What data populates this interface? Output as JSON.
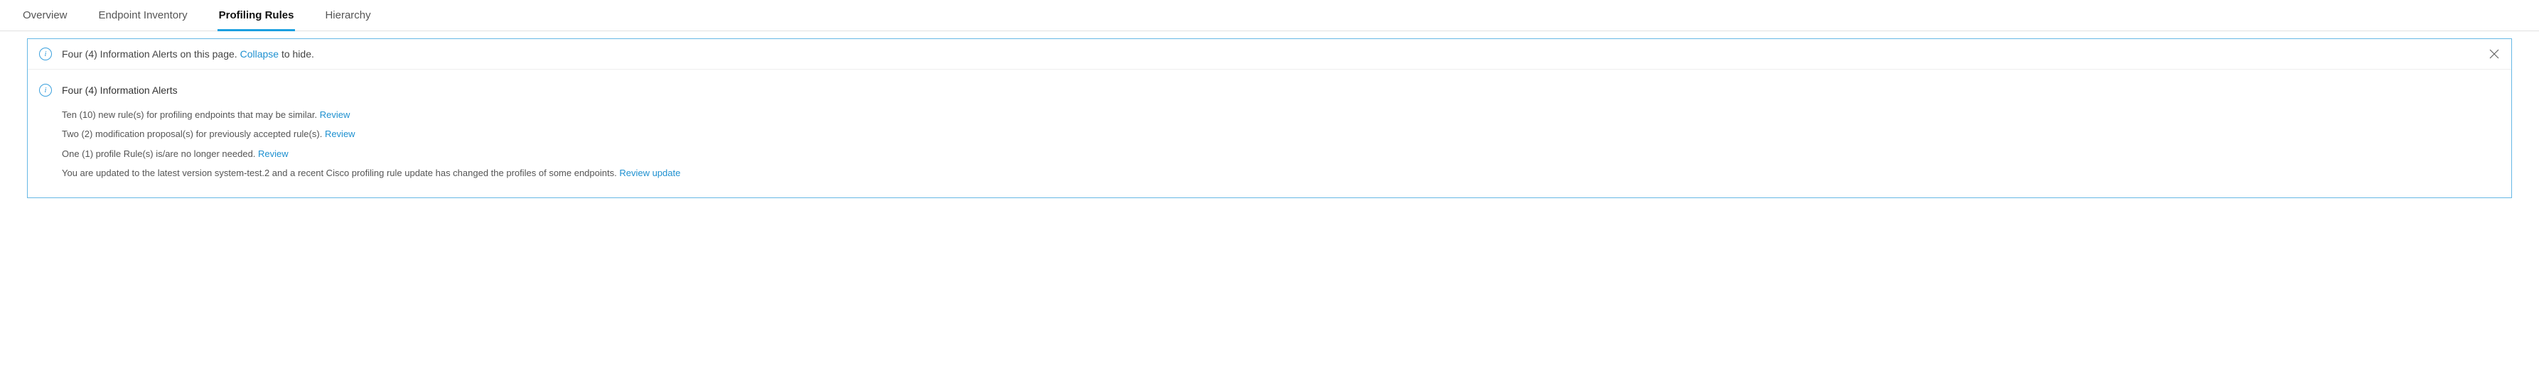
{
  "tabs": [
    {
      "label": "Overview",
      "active": false
    },
    {
      "label": "Endpoint Inventory",
      "active": false
    },
    {
      "label": "Profiling Rules",
      "active": true
    },
    {
      "label": "Hierarchy",
      "active": false
    }
  ],
  "alert": {
    "summary_prefix": "Four (4) Information Alerts on this page. ",
    "collapse_link": "Collapse",
    "summary_suffix": " to hide.",
    "details_title": "Four (4) Information Alerts",
    "items": [
      {
        "text": "Ten (10) new rule(s) for profiling endpoints that may be similar. ",
        "link": "Review"
      },
      {
        "text": "Two (2) modification proposal(s) for previously accepted rule(s). ",
        "link": "Review"
      },
      {
        "text": "One (1) profile Rule(s) is/are no longer needed. ",
        "link": "Review"
      },
      {
        "text": "You are updated to the latest version system-test.2 and a recent Cisco profiling rule update has changed the profiles of some endpoints. ",
        "link": "Review update"
      }
    ]
  }
}
